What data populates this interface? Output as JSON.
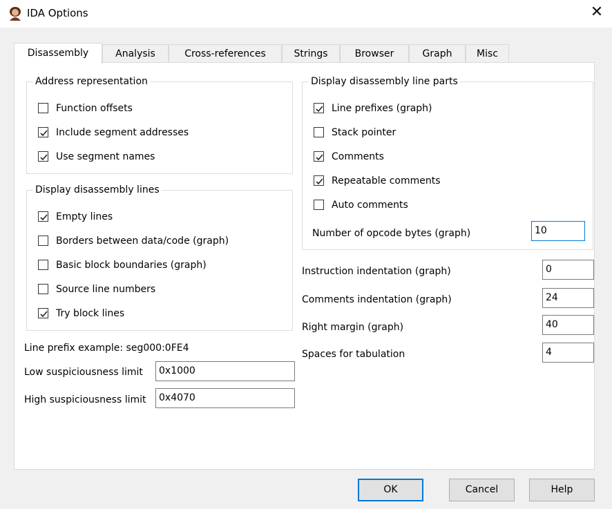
{
  "window": {
    "title": "IDA Options",
    "close_glyph": "✕"
  },
  "tabs": [
    "Disassembly",
    "Analysis",
    "Cross-references",
    "Strings",
    "Browser",
    "Graph",
    "Misc"
  ],
  "address_representation": {
    "legend": "Address representation",
    "items": [
      {
        "label": "Function offsets",
        "checked": false
      },
      {
        "label": "Include segment addresses",
        "checked": true
      },
      {
        "label": "Use segment names",
        "checked": true
      }
    ]
  },
  "display_lines": {
    "legend": "Display disassembly lines",
    "items": [
      {
        "label": "Empty lines",
        "checked": true
      },
      {
        "label": "Borders between data/code (graph)",
        "checked": false
      },
      {
        "label": "Basic block boundaries (graph)",
        "checked": false
      },
      {
        "label": "Source line numbers",
        "checked": false
      },
      {
        "label": "Try block lines",
        "checked": true
      }
    ]
  },
  "line_prefix_example": "Line prefix example: seg000:0FE4",
  "low_limit": {
    "label": "Low suspiciousness limit",
    "value": "0x1000"
  },
  "high_limit": {
    "label": "High suspiciousness limit",
    "value": "0x4070"
  },
  "line_parts": {
    "legend": "Display disassembly line parts",
    "items": [
      {
        "label": "Line prefixes (graph)",
        "checked": true
      },
      {
        "label": "Stack pointer",
        "checked": false
      },
      {
        "label": "Comments",
        "checked": true
      },
      {
        "label": "Repeatable comments",
        "checked": true
      },
      {
        "label": "Auto comments",
        "checked": false
      }
    ],
    "opcode_bytes": {
      "label": "Number of opcode bytes (graph)",
      "value": "10"
    }
  },
  "indentation": [
    {
      "label": "Instruction indentation (graph)",
      "value": "0"
    },
    {
      "label": "Comments indentation (graph)",
      "value": "24"
    },
    {
      "label": "Right margin (graph)",
      "value": "40"
    },
    {
      "label": "Spaces for tabulation",
      "value": "4"
    }
  ],
  "buttons": {
    "ok": "OK",
    "cancel": "Cancel",
    "help": "Help"
  },
  "colors": {
    "accent": "#0078d7",
    "panel": "#ffffff",
    "dialog": "#f0f0f0"
  }
}
